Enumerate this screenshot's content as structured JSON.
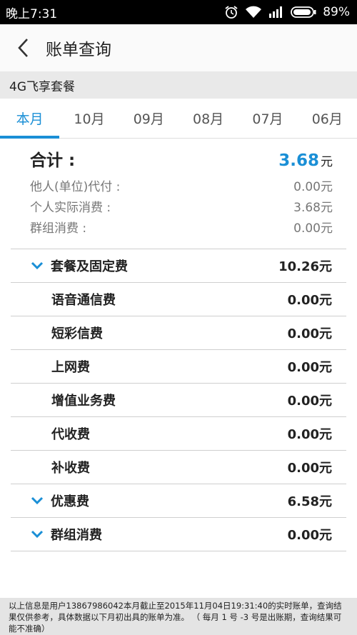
{
  "status": {
    "time": "晚上7:31",
    "battery": "89%"
  },
  "header": {
    "title": "账单查询"
  },
  "plan": {
    "name": "4G飞享套餐"
  },
  "tabs": [
    {
      "label": "本月",
      "active": true
    },
    {
      "label": "10月",
      "active": false
    },
    {
      "label": "09月",
      "active": false
    },
    {
      "label": "08月",
      "active": false
    },
    {
      "label": "07月",
      "active": false
    },
    {
      "label": "06月",
      "active": false
    }
  ],
  "summary": {
    "total_label": "合计 :",
    "total_value": "3.68",
    "total_unit": "元",
    "rows": [
      {
        "label": "他人(单位)代付 :",
        "value": "0.00元"
      },
      {
        "label": "个人实际消费 :",
        "value": "3.68元"
      },
      {
        "label": "群组消费 :",
        "value": "0.00元"
      }
    ]
  },
  "fees": [
    {
      "label": "套餐及固定费",
      "value": "10.26元",
      "type": "group"
    },
    {
      "label": "语音通信费",
      "value": "0.00元",
      "type": "child"
    },
    {
      "label": "短彩信费",
      "value": "0.00元",
      "type": "child"
    },
    {
      "label": "上网费",
      "value": "0.00元",
      "type": "child"
    },
    {
      "label": "增值业务费",
      "value": "0.00元",
      "type": "child"
    },
    {
      "label": "代收费",
      "value": "0.00元",
      "type": "child"
    },
    {
      "label": "补收费",
      "value": "0.00元",
      "type": "child"
    },
    {
      "label": "优惠费",
      "value": "6.58元",
      "type": "group"
    },
    {
      "label": "群组消费",
      "value": "0.00元",
      "type": "group"
    }
  ],
  "footer": {
    "text": "以上信息是用户13867986042本月截止至2015年11月04日19:31:40的实时账单，查询结果仅供参考，具体数据以下月初出具的账单为准。 （ 每月 1 号 -3 号是出账期，查询结果可能不准确）"
  },
  "colors": {
    "accent": "#1a8fd6"
  }
}
